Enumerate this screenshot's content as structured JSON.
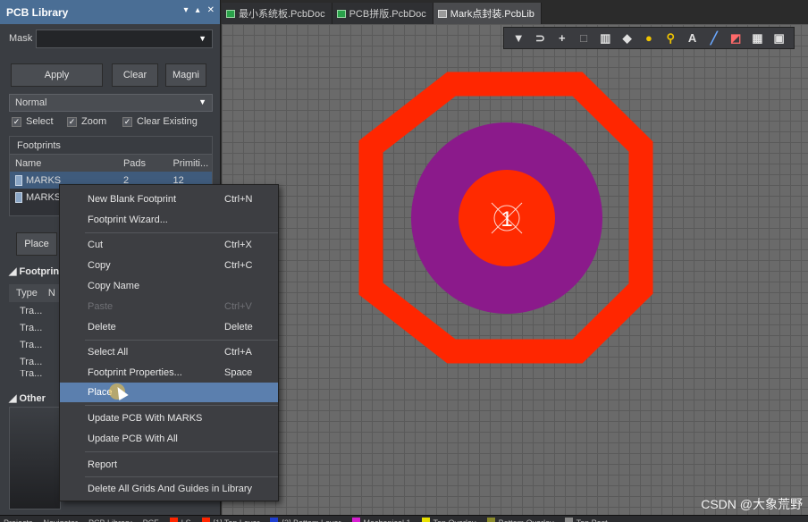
{
  "panel": {
    "title": "PCB Library",
    "controls": [
      "▾",
      "▴",
      "✕"
    ],
    "mask_label": "Mask",
    "mask_value": "",
    "buttons": {
      "apply": "Apply",
      "clear": "Clear",
      "magnify": "Magni"
    },
    "mode_select": "Normal",
    "checkboxes": {
      "select": "Select",
      "zoom": "Zoom",
      "clear_existing": "Clear Existing"
    },
    "footprints_title": "Footprints",
    "columns": {
      "name": "Name",
      "pads": "Pads",
      "primitives": "Primiti..."
    },
    "rows": [
      {
        "name": "MARKS",
        "pads": "2",
        "primitives": "12"
      },
      {
        "name": "MARKS",
        "pads": "",
        "primitives": ""
      }
    ],
    "place_button": "Place",
    "section_footprint": "Footprin",
    "prim_type_header": "Type",
    "prim_n_header": "N",
    "prim_rows": [
      "Tra...",
      "Tra...",
      "Tra...",
      "Tra...",
      "Tra..."
    ],
    "section_other": "Other"
  },
  "tabs": [
    {
      "label": "最小系统板.PcbDoc",
      "active": false
    },
    {
      "label": "PCB拼版.PcbDoc",
      "active": false
    },
    {
      "label": "Mark点封装.PcbLib",
      "active": true
    }
  ],
  "toolbar": {
    "icons": [
      "filter-icon",
      "route-icon",
      "cross-icon",
      "rect-icon",
      "chart-icon",
      "eraser-icon",
      "pad-icon",
      "via-icon",
      "text-icon",
      "line-icon",
      "region-icon",
      "graph-icon",
      "image-icon"
    ],
    "glyphs": [
      "▼",
      "⊃",
      "+",
      "□",
      "▥",
      "◆",
      "●",
      "⚲",
      "A",
      "╱",
      "◩",
      "▦",
      "▣"
    ],
    "colors": [
      "#e0e0e0",
      "#e0e0e0",
      "#e0e0e0",
      "#9a9a9a",
      "#e0e0e0",
      "#e0e0e0",
      "#f0c400",
      "#f0c400",
      "#e0e0e0",
      "#6aa8ff",
      "#ff6a6a",
      "#e0e0e0",
      "#e0e0e0"
    ]
  },
  "canvas": {
    "pad_number": "1",
    "colors": {
      "top_layer": "#ff2600",
      "mask": "#8b1a8b",
      "pad": "#ff2a00"
    }
  },
  "context_menu": {
    "items": [
      {
        "label": "New Blank Footprint",
        "shortcut": "Ctrl+N"
      },
      {
        "label": "Footprint Wizard...",
        "shortcut": ""
      },
      {
        "label": "Cut",
        "shortcut": "Ctrl+X"
      },
      {
        "label": "Copy",
        "shortcut": "Ctrl+C"
      },
      {
        "label": "Copy Name",
        "shortcut": ""
      },
      {
        "label": "Paste",
        "shortcut": "Ctrl+V"
      },
      {
        "label": "Delete",
        "shortcut": "Delete"
      },
      {
        "label": "Select All",
        "shortcut": "Ctrl+A"
      },
      {
        "label": "Footprint Properties...",
        "shortcut": "Space"
      },
      {
        "label": "Place",
        "shortcut": ""
      },
      {
        "label": "Update PCB With MARKS",
        "shortcut": ""
      },
      {
        "label": "Update PCB With All",
        "shortcut": ""
      },
      {
        "label": "Report",
        "shortcut": ""
      },
      {
        "label": "Delete All Grids And Guides in Library",
        "shortcut": ""
      }
    ]
  },
  "status_bar": {
    "items": [
      {
        "label": "Projects",
        "color": ""
      },
      {
        "label": "Navigator",
        "color": ""
      },
      {
        "label": "PCB Library",
        "color": ""
      },
      {
        "label": "PCF",
        "color": ""
      },
      {
        "label": "LS",
        "color": "#ff2600"
      },
      {
        "label": "[1] Top Layer",
        "color": "#ff2600"
      },
      {
        "label": "[2] Bottom Layer",
        "color": "#1f3fd0"
      },
      {
        "label": "Mechanical 1",
        "color": "#d61fd0"
      },
      {
        "label": "Top Overlay",
        "color": "#e8e000"
      },
      {
        "label": "Bottom Overlay",
        "color": "#8a8a2a"
      },
      {
        "label": "Top Past",
        "color": "#8a8a8a"
      }
    ]
  },
  "watermark": "CSDN @大象荒野"
}
